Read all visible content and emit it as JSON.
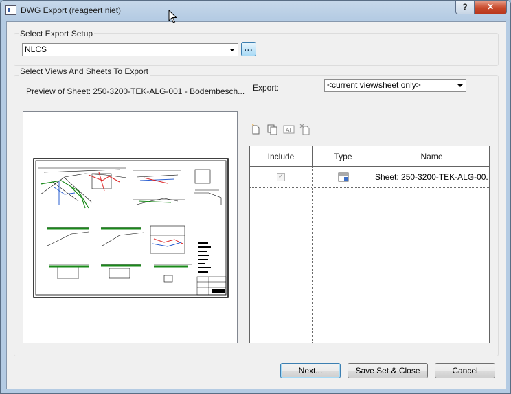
{
  "window": {
    "title": "DWG Export (reageert niet)",
    "help_label": "?",
    "close_label": "✕"
  },
  "export_setup": {
    "group_label": "Select Export Setup",
    "selected": "NLCS",
    "browse_label": "..."
  },
  "views_sheets": {
    "group_label": "Select Views And Sheets To Export",
    "preview_label": "Preview of Sheet: 250-3200-TEK-ALG-001 - Bodembesch...",
    "export_label": "Export:",
    "export_selected": "<current view/sheet only>"
  },
  "toolbar": {
    "icons": [
      "new-set-icon",
      "duplicate-set-icon",
      "rename-set-icon",
      "delete-set-icon"
    ]
  },
  "table": {
    "headers": [
      "Include",
      "Type",
      "Name"
    ],
    "rows": [
      {
        "include": true,
        "type_icon": "sheet-icon",
        "name": "Sheet: 250-3200-TEK-ALG-00..."
      }
    ]
  },
  "buttons": {
    "next": "Next...",
    "save_close": "Save Set & Close",
    "cancel": "Cancel"
  },
  "colors": {
    "title_bar": "#b4cbe3",
    "close_button": "#c84a2c",
    "default_button_border": "#3c7fb1",
    "dialog_background": "#f0f0f0"
  }
}
